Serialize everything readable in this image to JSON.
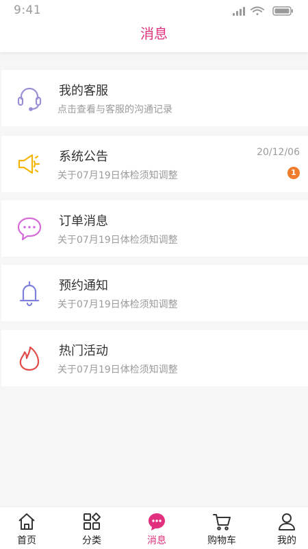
{
  "status": {
    "time": "9:41"
  },
  "header": {
    "title": "消息"
  },
  "messages": [
    {
      "icon": "headset-icon",
      "title": "我的客服",
      "subtitle": "点击查看与客服的沟通记录"
    },
    {
      "icon": "megaphone-icon",
      "title": "系统公告",
      "subtitle": "关于07月19日体检须知调整",
      "date": "20/12/06",
      "badge": "1"
    },
    {
      "icon": "chat-bubble-icon",
      "title": "订单消息",
      "subtitle": "关于07月19日体检须知调整"
    },
    {
      "icon": "bell-icon",
      "title": "预约通知",
      "subtitle": "关于07月19日体检须知调整"
    },
    {
      "icon": "flame-icon",
      "title": "热门活动",
      "subtitle": "关于07月19日体检须知调整"
    }
  ],
  "tabbar": {
    "items": [
      {
        "label": "首页",
        "icon": "home-icon"
      },
      {
        "label": "分类",
        "icon": "category-grid-icon"
      },
      {
        "label": "消息",
        "icon": "message-icon",
        "active": true
      },
      {
        "label": "购物车",
        "icon": "cart-icon"
      },
      {
        "label": "我的",
        "icon": "user-icon"
      }
    ]
  },
  "colors": {
    "accent": "#e0307e",
    "badge": "#f07b2c",
    "headset": "#9b8ed6",
    "megaphone": "#f5b400",
    "chat": "#d56bd8",
    "bell": "#7c7fdc",
    "flame": "#e24a4a"
  }
}
